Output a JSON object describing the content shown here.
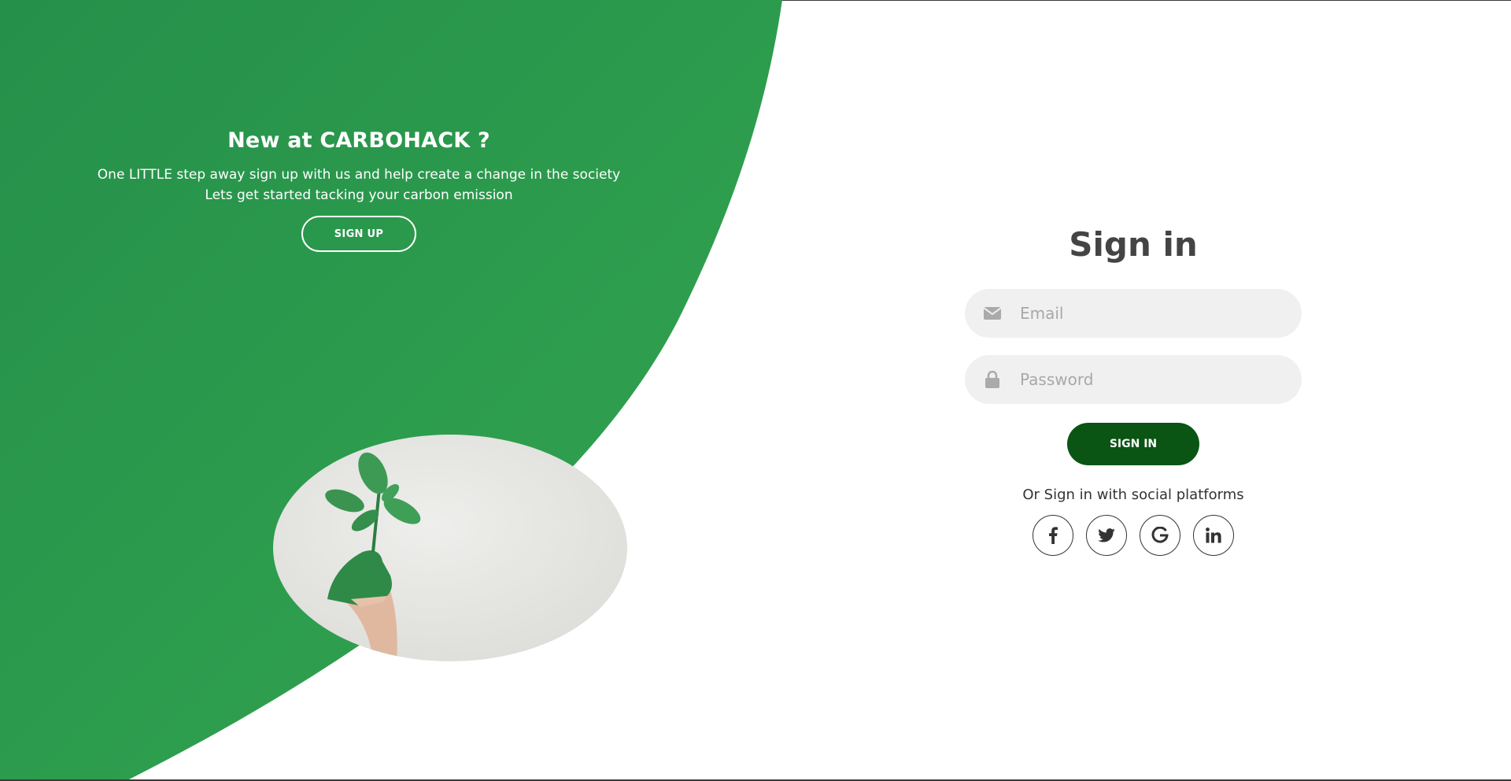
{
  "promo": {
    "title": "New at CARBOHACK ?",
    "line1": "One LITTLE step away sign up with us and help create a change in the society",
    "line2": "Lets get started tacking your carbon emission",
    "signup_label": "SIGN UP"
  },
  "signin": {
    "title": "Sign in",
    "email_placeholder": "Email",
    "password_placeholder": "Password",
    "button_label": "SIGN IN",
    "social_text": "Or Sign in with social platforms"
  },
  "social": {
    "icons": [
      "facebook-icon",
      "twitter-icon",
      "google-icon",
      "linkedin-icon"
    ]
  },
  "colors": {
    "green_panel": "#2a9a48",
    "signin_button": "#0a5514",
    "input_background": "#f0f0f0",
    "title_text": "#444444"
  }
}
